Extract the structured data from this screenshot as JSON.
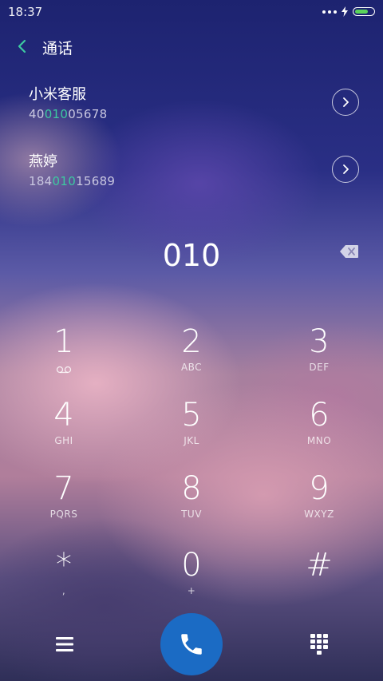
{
  "status_bar": {
    "time": "18:37",
    "battery_fraction": 0.75,
    "icons": [
      "more-dots-icon",
      "charging-bolt-icon",
      "battery-icon"
    ]
  },
  "header": {
    "title": "通话",
    "back_icon": "chevron-left-icon",
    "accent_color": "#3dc9a0"
  },
  "results": [
    {
      "name": "小米客服",
      "number_pre": "40",
      "number_match": "010",
      "number_post": "05678"
    },
    {
      "name": "燕婷",
      "number_pre": "184",
      "number_match": "010",
      "number_post": "15689"
    }
  ],
  "dial": {
    "input": "010",
    "delete_icon": "backspace-icon"
  },
  "keypad": [
    {
      "digit": "1",
      "letters": "",
      "sub_icon": "voicemail-icon"
    },
    {
      "digit": "2",
      "letters": "ABC"
    },
    {
      "digit": "3",
      "letters": "DEF"
    },
    {
      "digit": "4",
      "letters": "GHI"
    },
    {
      "digit": "5",
      "letters": "JKL"
    },
    {
      "digit": "6",
      "letters": "MNO"
    },
    {
      "digit": "7",
      "letters": "PQRS"
    },
    {
      "digit": "8",
      "letters": "TUV"
    },
    {
      "digit": "9",
      "letters": "WXYZ"
    },
    {
      "digit": "*",
      "letters": ","
    },
    {
      "digit": "0",
      "letters": "+"
    },
    {
      "digit": "#",
      "letters": ""
    }
  ],
  "bottom_bar": {
    "left_icon": "menu-icon",
    "center_icon": "phone-call-icon",
    "right_icon": "dialpad-icon",
    "call_color": "#1b6bc4"
  }
}
